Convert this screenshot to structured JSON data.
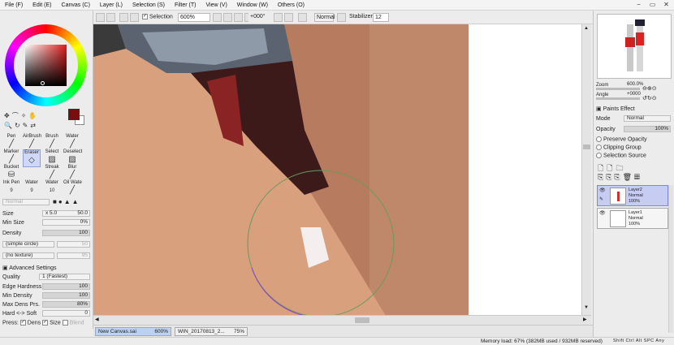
{
  "menubar": {
    "items": [
      "File (F)",
      "Edit (E)",
      "Canvas (C)",
      "Layer (L)",
      "Selection (S)",
      "Filter (T)",
      "View (V)",
      "Window (W)",
      "Others (O)"
    ],
    "window_buttons": [
      "−",
      "▭",
      "✕"
    ]
  },
  "toolbar": {
    "selection_label": "Selection",
    "zoom": "600%",
    "rotation": "+000°",
    "blend_mode": "Normal",
    "stabilizer_label": "Stabilizer",
    "stabilizer_value": "12"
  },
  "tools": {
    "row1": [
      "Pen",
      "AirBrush",
      "Brush",
      "Water"
    ],
    "row2": [
      "Marker",
      "Eraser",
      "Select",
      "Deselect"
    ],
    "row3": [
      "Bucket",
      "",
      "Streak",
      "Blur"
    ],
    "row4": [
      "Ink Pen",
      "Water",
      "Water",
      "Oil Wate"
    ],
    "row4_sizes": [
      "9",
      "9",
      "10",
      ""
    ]
  },
  "brush": {
    "blend_placeholder": "Normal",
    "size_label": "Size",
    "size_multiplier": "x 5.0",
    "size_value": "50.0",
    "min_size_label": "Min Size",
    "min_size_value": "0%",
    "density_label": "Density",
    "density_value": "100",
    "shape": "(simple circle)",
    "shape_value": "50",
    "texture": "(no texture)",
    "texture_value": "95",
    "advanced_label": "Advanced Settings",
    "quality_label": "Quality",
    "quality_value": "1 (Fastest)",
    "edge_hardness_label": "Edge Hardness",
    "edge_hardness_value": "100",
    "min_density_label": "Min Density",
    "min_density_value": "100",
    "max_dens_prs_label": "Max Dens Prs.",
    "max_dens_prs_value": "80%",
    "hard_soft_label": "Hard <-> Soft",
    "hard_soft_value": "0",
    "press_label": "Press:",
    "press_dens": "Dens",
    "press_size": "Size",
    "press_blend": "Blend"
  },
  "colors": {
    "primary": "#7a0d0d",
    "secondary": "#ffffff",
    "brush_circle": "#5a8a55"
  },
  "navigator": {
    "zoom_label": "Zoom",
    "zoom_value": "600.0%",
    "angle_label": "Angle",
    "angle_value": "+0000"
  },
  "layer_panel": {
    "paints_effect": "Paints Effect",
    "mode_label": "Mode",
    "mode_value": "Normal",
    "opacity_label": "Opacity",
    "opacity_value": "100%",
    "preserve_opacity": "Preserve Opacity",
    "clipping_group": "Clipping Group",
    "selection_source": "Selection Source",
    "layers": [
      {
        "name": "Layer2",
        "mode": "Normal",
        "opacity": "100%"
      },
      {
        "name": "Layer1",
        "mode": "Normal",
        "opacity": "100%"
      }
    ]
  },
  "tabs": [
    {
      "name": "New Canvas.sai",
      "zoom": "600%"
    },
    {
      "name": "WIN_20170813_2...",
      "zoom": "75%"
    }
  ],
  "status": {
    "memory": "Memory load: 67% (382MB used / 932MB reserved)",
    "indicators": [
      "Shift",
      "Ctrl",
      "Alt",
      "SPC",
      "Any"
    ]
  }
}
